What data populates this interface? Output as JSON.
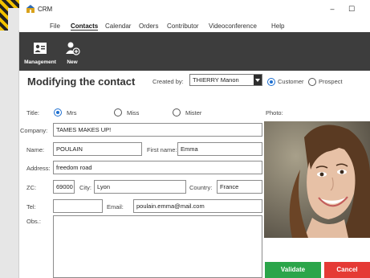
{
  "window": {
    "title": "CRM",
    "minimize_glyph": "–",
    "maximize_glyph": "☐"
  },
  "menu": {
    "items": [
      {
        "label": "File"
      },
      {
        "label": "Contacts",
        "active": true
      },
      {
        "label": "Calendar"
      },
      {
        "label": "Orders"
      },
      {
        "label": "Contributor"
      },
      {
        "label": "Videoconference"
      },
      {
        "label": "Help"
      }
    ]
  },
  "toolbar": {
    "items": [
      {
        "label": "Management",
        "icon": "contact-card-icon"
      },
      {
        "label": "New",
        "icon": "add-user-icon"
      }
    ]
  },
  "form": {
    "title": "Modifying the contact",
    "created_by_label": "Created by:",
    "created_by_value": "THIERRY Manon",
    "contact_type": {
      "options": [
        "Customer",
        "Prospect"
      ],
      "selected": "Customer"
    },
    "title_label": "Title:",
    "title_options": {
      "options": [
        "Mrs",
        "Miss",
        "Mister"
      ],
      "selected": "Mrs"
    },
    "photo_label": "Photo:",
    "company_label": "Company:",
    "company_value": "TAMES MAKES UP!",
    "name_label": "Name:",
    "name_value": "POULAIN",
    "first_name_label": "First name:",
    "first_name_value": "Emma",
    "address_label": "Address:",
    "address_value": "freedom road",
    "zc_label": "ZC:",
    "zc_value": "69000",
    "city_label": "City:",
    "city_value": "Lyon",
    "country_label": "Country:",
    "country_value": "France",
    "tel_label": "Tel:",
    "tel_value": "",
    "email_label": "Email:",
    "email_value": "poulain.emma@mail.com",
    "obs_label": "Obs.:",
    "obs_value": ""
  },
  "buttons": {
    "validate": "Validate",
    "cancel": "Cancel"
  },
  "colors": {
    "toolbar_bg": "#3d3d3d",
    "validate": "#2ba54a",
    "cancel": "#e53a35",
    "radio_accent": "#1e6fd0"
  }
}
